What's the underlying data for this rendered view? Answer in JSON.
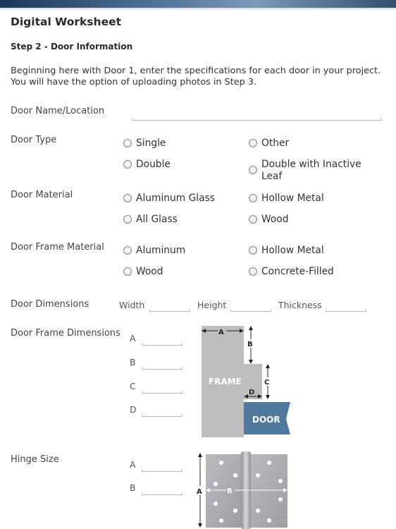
{
  "page": {
    "title": "Digital Worksheet",
    "step": "Step 2 - Door Information",
    "intro": "Beginning here with Door 1, enter the specifications for each door in your project. You will have the option of uploading photos in Step 3."
  },
  "door_name": {
    "label": "Door Name/Location",
    "value": ""
  },
  "door_type": {
    "label": "Door Type",
    "options": [
      "Single",
      "Other",
      "Double",
      "Double with Inactive Leaf"
    ]
  },
  "door_material": {
    "label": "Door Material",
    "options": [
      "Aluminum Glass",
      "Hollow Metal",
      "All Glass",
      "Wood"
    ]
  },
  "frame_material": {
    "label": "Door Frame Material",
    "options": [
      "Aluminum",
      "Hollow Metal",
      "Wood",
      "Concrete-Filled"
    ]
  },
  "dimensions": {
    "label": "Door Dimensions",
    "width_label": "Width",
    "height_label": "Height",
    "thickness_label": "Thickness",
    "width": "",
    "height": "",
    "thickness": ""
  },
  "frame_dimensions": {
    "label": "Door Frame Dimensions",
    "fields": [
      "A",
      "B",
      "C",
      "D"
    ],
    "diagram": {
      "frame_text": "FRAME",
      "door_text": "DOOR",
      "labels": [
        "A",
        "B",
        "C",
        "D"
      ],
      "frame_color": "#bdbdbd",
      "door_color": "#4f7a9e"
    }
  },
  "hinge": {
    "label": "Hinge Size",
    "fields": [
      "A",
      "B"
    ],
    "diagram": {
      "labels": [
        "A",
        "B"
      ],
      "leaf_color": "#a9abae"
    }
  }
}
